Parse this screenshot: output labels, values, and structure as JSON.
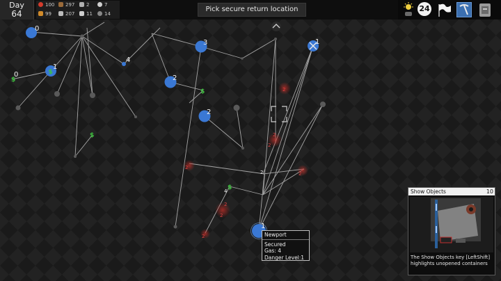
{
  "topbar": {
    "day_label": "Day",
    "day_number": "64",
    "stats": [
      {
        "icon": "health-icon",
        "value": "100",
        "color": "#d33b2c"
      },
      {
        "icon": "stick-icon",
        "value": "297",
        "color": "#9a6a3a"
      },
      {
        "icon": "parts-icon",
        "value": "2",
        "color": "#b0b0b0"
      },
      {
        "icon": "stamina-icon",
        "value": "7",
        "color": "#d0d0d0"
      },
      {
        "icon": "food-icon",
        "value": "99",
        "color": "#d08a2a"
      },
      {
        "icon": "ammo-icon",
        "value": "207",
        "color": "#bbbbbb"
      },
      {
        "icon": "bones-icon",
        "value": "11",
        "color": "#cfcfcf"
      },
      {
        "icon": "clock-icon",
        "value": "14",
        "color": "#888888"
      }
    ],
    "objective": "Pick secure return location",
    "time_badge": "24",
    "tray_icons": [
      "weather-icon",
      "time-badge",
      "flag-icon",
      "pickaxe-tool-icon",
      "backpack-icon"
    ]
  },
  "map": {
    "route_nodes": [
      {
        "name": "node-west-top",
        "label": "0"
      },
      {
        "name": "node-west-dollar",
        "label": "1"
      },
      {
        "name": "node-north-small",
        "label": "4"
      },
      {
        "name": "node-center-north",
        "label": "3"
      },
      {
        "name": "node-northeast-target",
        "label": "1"
      },
      {
        "name": "node-mid-west",
        "label": "2"
      },
      {
        "name": "node-center",
        "label": "2"
      },
      {
        "name": "node-far-west",
        "label": "0"
      },
      {
        "name": "node-newport",
        "label": "1"
      }
    ],
    "danger_markers": [
      "2",
      "2",
      "2",
      "2",
      "2",
      "2",
      "2",
      "2"
    ],
    "waypoint_labels": [
      "2",
      "4"
    ]
  },
  "location_popup": {
    "name": "Newport",
    "status": "Secured",
    "gas": "Gas: 4",
    "danger": "Danger Level:1"
  },
  "hint_panel": {
    "title": "Show Objects",
    "counter": "10",
    "text": "The Show Objects key [LeftShift] highlights unopened containers"
  },
  "colors": {
    "node_blue": "#3a78d4",
    "cash_green": "#3fc23f",
    "danger_red": "#c0302a",
    "line": "#c8c8c8"
  }
}
